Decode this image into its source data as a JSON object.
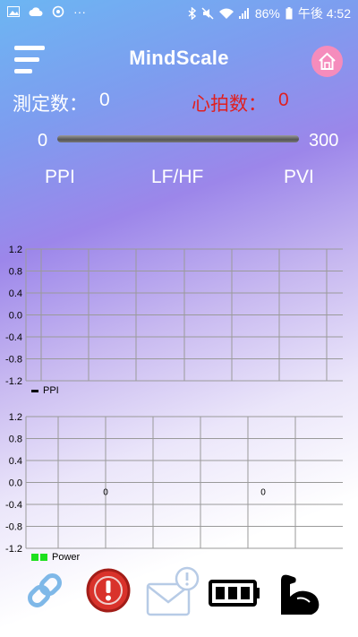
{
  "status_bar": {
    "battery": "86%",
    "time": "午後 4:52",
    "overflow": "···"
  },
  "header": {
    "title": "MindScale",
    "menu_icon": "hamburger-menu-icon",
    "home_icon": "home-icon"
  },
  "stats": {
    "measure_label": "測定数：",
    "measure_value": "0",
    "heartbeat_label": "心拍数：",
    "heartbeat_value": "0",
    "heartbeat_color": "#e01f1f"
  },
  "slider": {
    "min": "0",
    "max": "300",
    "value": 0
  },
  "metrics": {
    "ppi": "PPI",
    "lfhf": "LF/HF",
    "pvi": "PVI"
  },
  "chart_data": [
    {
      "type": "line",
      "yticks": [
        "1.2",
        "0.8",
        "0.4",
        "0.0",
        "-0.4",
        "-0.8",
        "-1.2"
      ],
      "ylim": [
        -1.2,
        1.2
      ],
      "grid": true,
      "legend": "PPI",
      "legend_placement": "bottom-left",
      "series": [
        {
          "name": "PPI",
          "values": []
        }
      ]
    },
    {
      "type": "bar",
      "yticks": [
        "1.2",
        "0.8",
        "0.4",
        "0.0",
        "-0.4",
        "-0.8",
        "-1.2"
      ],
      "ylim": [
        -1.2,
        1.2
      ],
      "grid": true,
      "legend": "Power",
      "legend_placement": "bottom-left",
      "legend_color": "#1ee01e",
      "series": [
        {
          "name": "Power",
          "values": [
            0,
            0
          ]
        }
      ],
      "value_labels": [
        "0",
        "0"
      ]
    }
  ],
  "toolbar": {
    "items": [
      {
        "icon": "link-icon"
      },
      {
        "icon": "alert-icon"
      },
      {
        "icon": "mail-alert-icon"
      },
      {
        "icon": "battery-icon"
      },
      {
        "icon": "flex-arm-icon"
      }
    ]
  }
}
